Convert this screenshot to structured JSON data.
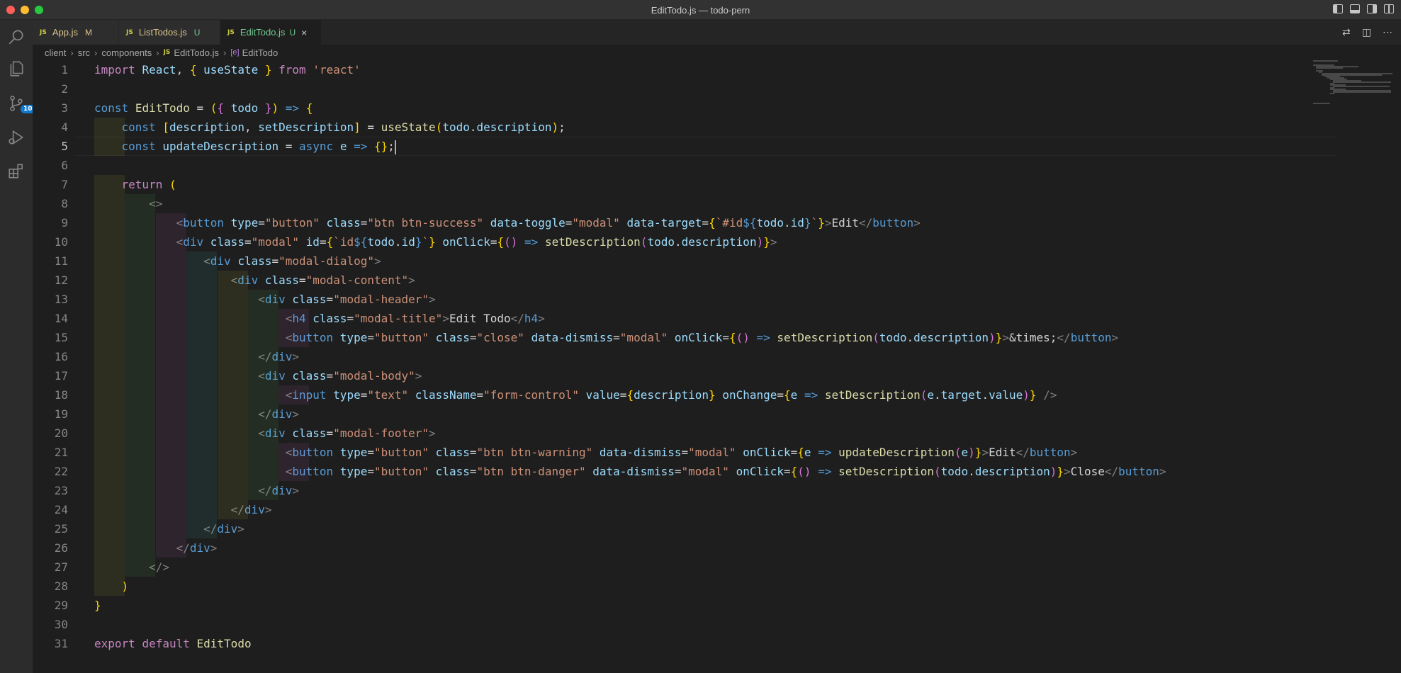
{
  "window": {
    "title": "EditTodo.js — todo-pern"
  },
  "activity": {
    "items": [
      "explorer",
      "search",
      "source-control",
      "run-debug",
      "extensions"
    ],
    "scm_badge": "10"
  },
  "tabs": [
    {
      "icon": "JS",
      "label": "App.js",
      "status": "M"
    },
    {
      "icon": "JS",
      "label": "ListTodos.js",
      "status": "U"
    },
    {
      "icon": "JS",
      "label": "EditTodo.js",
      "status": "U",
      "active": true
    }
  ],
  "breadcrumb": {
    "parts": [
      "client",
      "src",
      "components",
      "EditTodo.js",
      "EditTodo"
    ]
  },
  "editor": {
    "current_line": 5,
    "line_numbers": [
      "1",
      "2",
      "3",
      "4",
      "5",
      "6",
      "7",
      "8",
      "9",
      "10",
      "11",
      "12",
      "13",
      "14",
      "15",
      "16",
      "17",
      "18",
      "19",
      "20",
      "21",
      "22",
      "23",
      "24",
      "25",
      "26",
      "27",
      "28",
      "29",
      "30",
      "31"
    ],
    "code": [
      "import React, { useState } from 'react'",
      "",
      "const EditTodo = ({ todo }) => {",
      "    const [description, setDescription] = useState(todo.description);",
      "    const updateDescription = async e => {};",
      "",
      "    return (",
      "        <>",
      "            <button type=\"button\" class=\"btn btn-success\" data-toggle=\"modal\" data-target={`#id${todo.id}`}>Edit</button>",
      "            <div class=\"modal\" id={`id${todo.id}`} onClick={() => setDescription(todo.description)}>",
      "                <div class=\"modal-dialog\">",
      "                    <div class=\"modal-content\">",
      "                        <div class=\"modal-header\">",
      "                            <h4 class=\"modal-title\">Edit Todo</h4>",
      "                            <button type=\"button\" class=\"close\" data-dismiss=\"modal\" onClick={() => setDescription(todo.description)}>&times;</button>",
      "                        </div>",
      "                        <div class=\"modal-body\">",
      "                            <input type=\"text\" className=\"form-control\" value={description} onChange={e => setDescription(e.target.value)} />",
      "                        </div>",
      "                        <div class=\"modal-footer\">",
      "                            <button type=\"button\" class=\"btn btn-warning\" data-dismiss=\"modal\" onClick={e => updateDescription(e)}>Edit</button>",
      "                            <button type=\"button\" class=\"btn btn-danger\" data-dismiss=\"modal\" onClick={() => setDescription(todo.description)}>Close</button>",
      "                        </div>",
      "                    </div>",
      "                </div>",
      "            </div>",
      "        </>",
      "    )",
      "}",
      "",
      "export default EditTodo"
    ]
  }
}
